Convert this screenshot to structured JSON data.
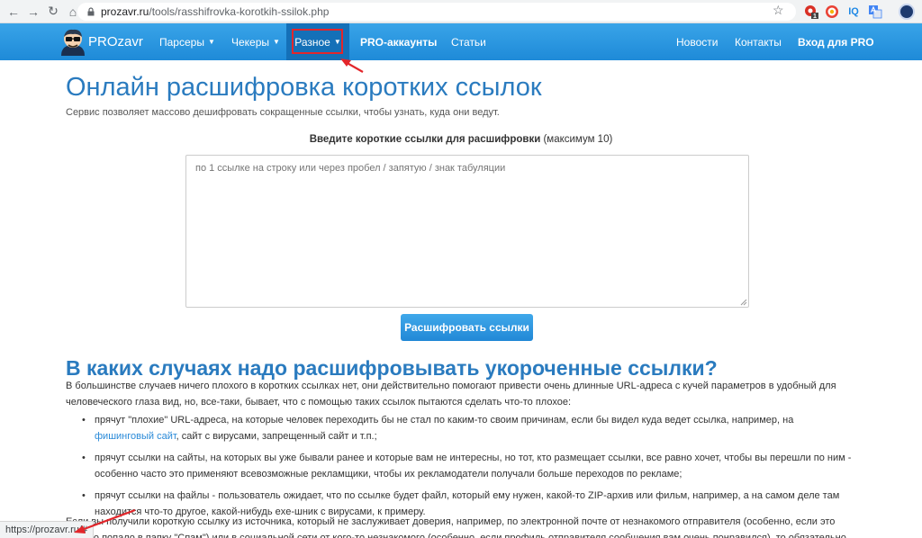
{
  "browser": {
    "url_host": "prozavr.ru",
    "url_path": "/tools/rasshifrovka-korotkih-ssilok.php",
    "ext_badge": "1",
    "ext_iq": "IQ",
    "status_url": "https://prozavr.ru/#"
  },
  "navbar": {
    "brand": "PROzavr",
    "items": [
      {
        "label": "Парсеры",
        "caret": "▼"
      },
      {
        "label": "Чекеры",
        "caret": "▼"
      },
      {
        "label": "Разное",
        "caret": "▼"
      },
      {
        "label": "PRO-аккаунты"
      },
      {
        "label": "Статьи"
      }
    ],
    "right_items": [
      {
        "label": "Новости"
      },
      {
        "label": "Контакты"
      },
      {
        "label": "Вход для PRO"
      }
    ]
  },
  "page": {
    "title": "Онлайн расшифровка коротких ссылок",
    "subtitle": "Сервис позволяет массово дешифровать сокращенные ссылки, чтобы узнать, куда они ведут.",
    "form_label_strong": "Введите короткие ссылки для расшифровки",
    "form_label_extra": " (максимум 10)",
    "textarea_placeholder": "по 1 ссылке на строку или через пробел / запятую / знак табуляции",
    "submit_label": "Расшифровать ссылки",
    "h2": "В каких случаях надо расшифровывать укороченные ссылки?",
    "p1": "В большинстве случаев ничего плохого в коротких ссылках нет, они действительно помогают привести очень длинные URL-адреса с кучей параметров в удобный для человеческого глаза вид, но, все-таки, бывает, что с помощью таких ссылок пытаются сделать что-то плохое:",
    "b1_before": "прячут \"плохие\" URL-адреса, на которые человек переходить бы не стал по каким-то своим причинам, если бы видел куда ведет ссылка, например, на ",
    "b1_link": "фишинговый сайт",
    "b1_after": ", сайт с вирусами, запрещенный сайт и т.п.;",
    "b2": "прячут ссылки на сайты, на которых вы уже бывали ранее и которые вам не интересны, но тот, кто размещает ссылки, все равно хочет, чтобы вы перешли по ним - особенно часто это применяют всевозможные рекламщики, чтобы их рекламодатели получали больше переходов по рекламе;",
    "b3": "прячут ссылки на файлы - пользователь ожидает, что по ссылке будет файл, который ему нужен, какой-то ZIP-архив или фильм, например, а на самом деле там находится что-то другое, какой-нибудь exe-шник с вирусами, к примеру.",
    "p2": "Если вы получили короткую ссылку из источника, который не заслуживает доверия, например, по электронной почте от незнакомого отправителя (особенно, если это письмо попало в папку \"Спам\") или в социальной сети от кого-то незнакомого (особенно, если профиль отправителя сообщения вам очень понравился), то обязательно узнайте"
  },
  "colors": {
    "accent": "#2a7bbf",
    "navbar": "#2290dc",
    "annotation": "#e3262b"
  }
}
